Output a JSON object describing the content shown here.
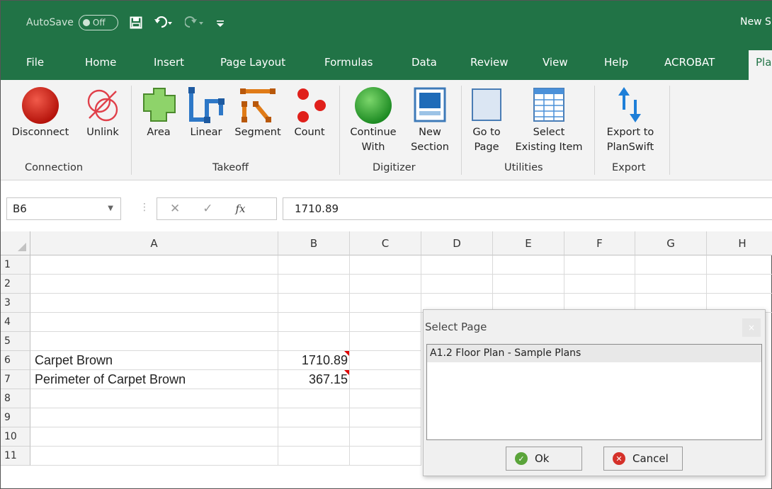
{
  "titlebar": {
    "autosave_label": "AutoSave",
    "autosave_state": "Off",
    "doc_title": "New S"
  },
  "tabs": [
    "File",
    "Home",
    "Insert",
    "Page Layout",
    "Formulas",
    "Data",
    "Review",
    "View",
    "Help",
    "ACROBAT",
    "Pla"
  ],
  "active_tab_index": 10,
  "ribbon": {
    "buttons": {
      "disconnect": "Disconnect",
      "unlink": "Unlink",
      "area": "Area",
      "linear": "Linear",
      "segment": "Segment",
      "count": "Count",
      "continue_1": "Continue",
      "continue_2": "With",
      "new_1": "New",
      "new_2": "Section",
      "goto_1": "Go to",
      "goto_2": "Page",
      "select_1": "Select",
      "select_2": "Existing Item",
      "export_1": "Export to",
      "export_2": "PlanSwift"
    },
    "groups": {
      "connection": "Connection",
      "takeoff": "Takeoff",
      "digitizer": "Digitizer",
      "utilities": "Utilities",
      "export": "Export"
    }
  },
  "formula_bar": {
    "name_box": "B6",
    "formula": "1710.89"
  },
  "sheet": {
    "columns": [
      "A",
      "B",
      "C",
      "D",
      "E",
      "F",
      "G",
      "H"
    ],
    "rows": [
      "1",
      "2",
      "3",
      "4",
      "5",
      "6",
      "7",
      "8",
      "9",
      "10",
      "11"
    ],
    "cells": {
      "A6": "Carpet Brown",
      "B6": "1710.89",
      "A7": "Perimeter of Carpet Brown",
      "B7": "367.15"
    }
  },
  "dialog": {
    "title": "Select Page",
    "close_glyph": "×",
    "items": [
      "A1.2 Floor Plan - Sample Plans"
    ],
    "ok_label": "Ok",
    "cancel_label": "Cancel"
  },
  "colors": {
    "excel_green": "#217346",
    "ribbon_bg": "#f3f3f3",
    "comment_marker": "#e00000"
  },
  "icons": [
    "save-icon",
    "undo-icon",
    "redo-icon",
    "customize-qat-icon",
    "disconnect-icon",
    "unlink-icon",
    "area-icon",
    "linear-icon",
    "segment-icon",
    "count-icon",
    "continue-with-icon",
    "new-section-icon",
    "go-to-page-icon",
    "select-existing-item-icon",
    "export-arrows-icon",
    "ok-check-icon",
    "cancel-x-icon"
  ]
}
